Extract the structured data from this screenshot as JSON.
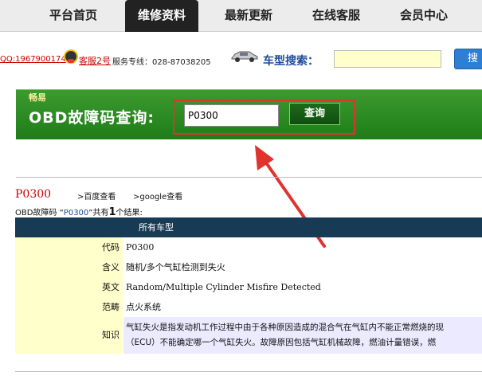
{
  "nav": {
    "items": [
      {
        "label": "平台首页"
      },
      {
        "label": "维修资料"
      },
      {
        "label": "最新更新"
      },
      {
        "label": "在线客服"
      },
      {
        "label": "会员中心"
      }
    ],
    "active_index": 1
  },
  "info": {
    "qq": "QQ:1967900174",
    "kf2": "客服2号",
    "hotline": "服务专线：028-87038205",
    "search_label": "车型搜索：",
    "search_value": "",
    "search_button": "搜"
  },
  "obd": {
    "small_label": "畅易",
    "title": "OBD故障码查询:",
    "input_value": "P0300",
    "button": "查询"
  },
  "result": {
    "code": "P0300",
    "baidu": ">百度查看",
    "google": ">google查看",
    "prefix": "OBD故障码  “",
    "code_q": "P0300",
    "mid": "”共有",
    "count": "1",
    "suffix": "个结果:"
  },
  "table": {
    "header": "所有车型",
    "rows": [
      {
        "k": "代码",
        "v": "P0300"
      },
      {
        "k": "含义",
        "v": "随机/多个气缸检测到失火"
      },
      {
        "k": "英文",
        "v": "Random/Multiple Cylinder Misfire Detected"
      },
      {
        "k": "范畴",
        "v": "点火系统"
      }
    ],
    "knowledge_key": "知识",
    "knowledge_line1": "气缸失火是指发动机工作过程中由于各种原因造成的混合气在气缸内不能正常燃烧的现",
    "knowledge_line2": "（ECU）不能确定哪一个气缸失火。故障原因包括气缸机械故障，燃油计量错误，燃"
  },
  "colors": {
    "accent_red": "#e0332e",
    "obd_green": "#2a8a22",
    "table_header": "#173a55"
  }
}
